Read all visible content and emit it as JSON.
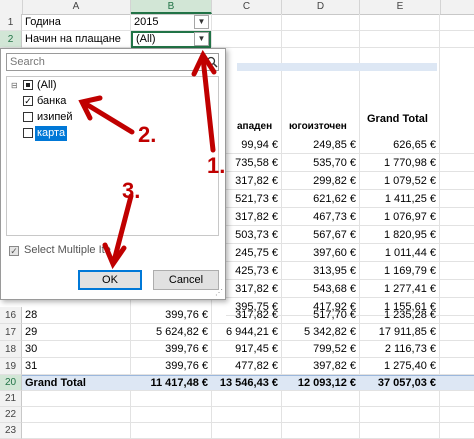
{
  "columns": [
    "A",
    "B",
    "C",
    "D",
    "E"
  ],
  "rows_top": [
    {
      "num": "1",
      "label": "Година",
      "value": "2015"
    },
    {
      "num": "2",
      "label": "Начин на плащане",
      "value": "(All)"
    }
  ],
  "pivot_headers": {
    "c": "ападен",
    "d": "югоизточен",
    "e": "Grand Total"
  },
  "partial_rows": [
    {
      "c": "99,94 €",
      "d": "249,85 €",
      "e": "626,65 €"
    },
    {
      "c": "735,58 €",
      "d": "535,70 €",
      "e": "1 770,98 €"
    },
    {
      "c": "317,82 €",
      "d": "299,82 €",
      "e": "1 079,52 €"
    },
    {
      "c": "521,73 €",
      "d": "621,62 €",
      "e": "1 411,25 €"
    },
    {
      "c": "317,82 €",
      "d": "467,73 €",
      "e": "1 076,97 €"
    },
    {
      "c": "503,73 €",
      "d": "567,67 €",
      "e": "1 820,95 €"
    },
    {
      "c": "245,75 €",
      "d": "397,60 €",
      "e": "1 011,44 €"
    },
    {
      "c": "425,73 €",
      "d": "313,95 €",
      "e": "1 169,79 €"
    },
    {
      "c": "317,82 €",
      "d": "543,68 €",
      "e": "1 277,41 €"
    },
    {
      "c": "395,75 €",
      "d": "417,92 €",
      "e": "1 155,61 €"
    }
  ],
  "full_rows": [
    {
      "num": "16",
      "a": "28",
      "b": "399,76 €",
      "c": "317,82 €",
      "d": "517,70 €",
      "e": "1 235,28 €"
    },
    {
      "num": "17",
      "a": "29",
      "b": "5 624,82 €",
      "c": "6 944,21 €",
      "d": "5 342,82 €",
      "e": "17 911,85 €"
    },
    {
      "num": "18",
      "a": "30",
      "b": "399,76 €",
      "c": "917,45 €",
      "d": "799,52 €",
      "e": "2 116,73 €"
    },
    {
      "num": "19",
      "a": "31",
      "b": "399,76 €",
      "c": "477,82 €",
      "d": "397,82 €",
      "e": "1 275,40 €"
    }
  ],
  "grand_total": {
    "num": "20",
    "label": "Grand Total",
    "b": "11 417,48 €",
    "c": "13 546,43 €",
    "d": "12 093,12 €",
    "e": "37 057,03 €"
  },
  "empty_rows": [
    "21",
    "22",
    "23"
  ],
  "filter_dialog": {
    "search_placeholder": "Search",
    "items": [
      "(All)",
      "банка",
      "изипей",
      "карта"
    ],
    "select_multiple": "Select Multiple Ite",
    "ok": "OK",
    "cancel": "Cancel"
  },
  "annotations": [
    "1.",
    "2.",
    "3."
  ],
  "annotation_color": "#c00000"
}
